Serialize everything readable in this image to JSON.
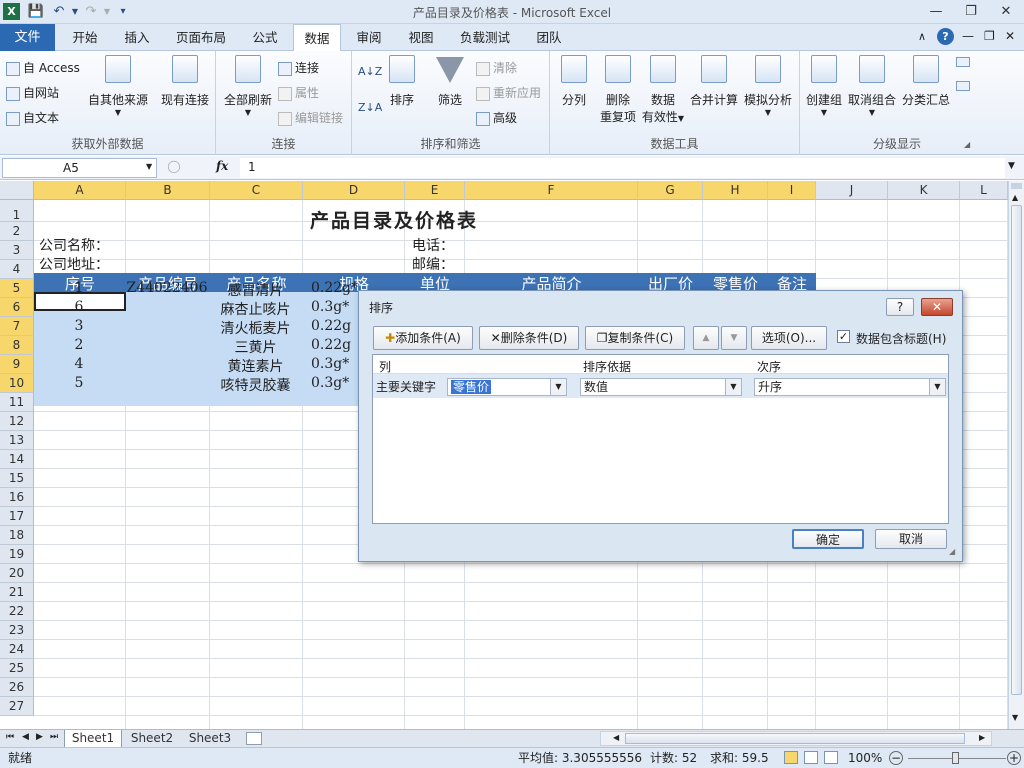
{
  "window": {
    "title": "产品目录及价格表  -  Microsoft Excel"
  },
  "menu_tabs": [
    "文件",
    "开始",
    "插入",
    "页面布局",
    "公式",
    "数据",
    "审阅",
    "视图",
    "负载测试",
    "团队"
  ],
  "active_tab": "数据",
  "ribbon": {
    "get_external": {
      "access": "自 Access",
      "web": "自网站",
      "text": "自文本",
      "other": "自其他来源",
      "existing": "现有连接",
      "label": "获取外部数据"
    },
    "connections": {
      "refresh_all": "全部刷新",
      "connections": "连接",
      "properties": "属性",
      "edit_links": "编辑链接",
      "label": "连接"
    },
    "sort_filter": {
      "sort": "排序",
      "filter": "筛选",
      "clear": "清除",
      "reapply": "重新应用",
      "advanced": "高级",
      "label": "排序和筛选"
    },
    "data_tools": {
      "text_to_cols": "分列",
      "remove_dup": "删除\n重复项",
      "remove_dup1": "删除",
      "remove_dup2": "重复项",
      "validation1": "数据",
      "validation2": "有效性",
      "consolidate": "合并计算",
      "whatif": "模拟分析",
      "label": "数据工具"
    },
    "outline": {
      "group": "创建组",
      "ungroup": "取消组合",
      "subtotal": "分类汇总",
      "label": "分级显示"
    }
  },
  "formula_bar": {
    "name_box": "A5",
    "fx": "fx",
    "value": "1"
  },
  "columns": [
    "A",
    "B",
    "C",
    "D",
    "E",
    "F",
    "G",
    "H",
    "I",
    "J",
    "K",
    "L"
  ],
  "rows": [
    "1",
    "2",
    "3",
    "4",
    "5",
    "6",
    "7",
    "8",
    "9",
    "10",
    "11",
    "12",
    "13",
    "14",
    "15",
    "16",
    "17",
    "18",
    "19",
    "20",
    "21",
    "22",
    "23",
    "24",
    "25",
    "26",
    "27"
  ],
  "sheet": {
    "title": "产品目录及价格表",
    "company_name": "公司名称：",
    "company_addr": "公司地址：",
    "phone": "电话：",
    "postcode": "邮编：",
    "headers": [
      "序号",
      "产品编号",
      "产品名称",
      "规格",
      "单位",
      "产品简介",
      "出厂价",
      "零售价",
      "备注"
    ],
    "data": [
      [
        "1",
        "Z44022406",
        "感冒清片",
        "0.22g*"
      ],
      [
        "6",
        "",
        "麻杏止咳片",
        "0.3g*"
      ],
      [
        "3",
        "",
        "清火栀麦片",
        "0.22g"
      ],
      [
        "2",
        "",
        "三黄片",
        "0.22g"
      ],
      [
        "4",
        "",
        "黄连素片",
        "0.3g*"
      ],
      [
        "5",
        "",
        "咳特灵胶囊",
        "0.3g*"
      ]
    ]
  },
  "dialog": {
    "title": "排序",
    "help": "?",
    "close": "✕",
    "add_level": "添加条件(A)",
    "delete_level": "删除条件(D)",
    "copy_level": "复制条件(C)",
    "options": "选项(O)...",
    "has_headers": "数据包含标题(H)",
    "col_header_column": "列",
    "col_header_sorton": "排序依据",
    "col_header_order": "次序",
    "row_label": "主要关键字",
    "sort_by": "零售价",
    "sort_on": "数值",
    "order": "升序",
    "ok": "确定",
    "cancel": "取消"
  },
  "sheet_tabs": [
    "Sheet1",
    "Sheet2",
    "Sheet3"
  ],
  "status": {
    "ready": "就绪",
    "average": "平均值: 3.305555556",
    "count": "计数: 52",
    "sum": "求和: 59.5",
    "zoom": "100%"
  }
}
